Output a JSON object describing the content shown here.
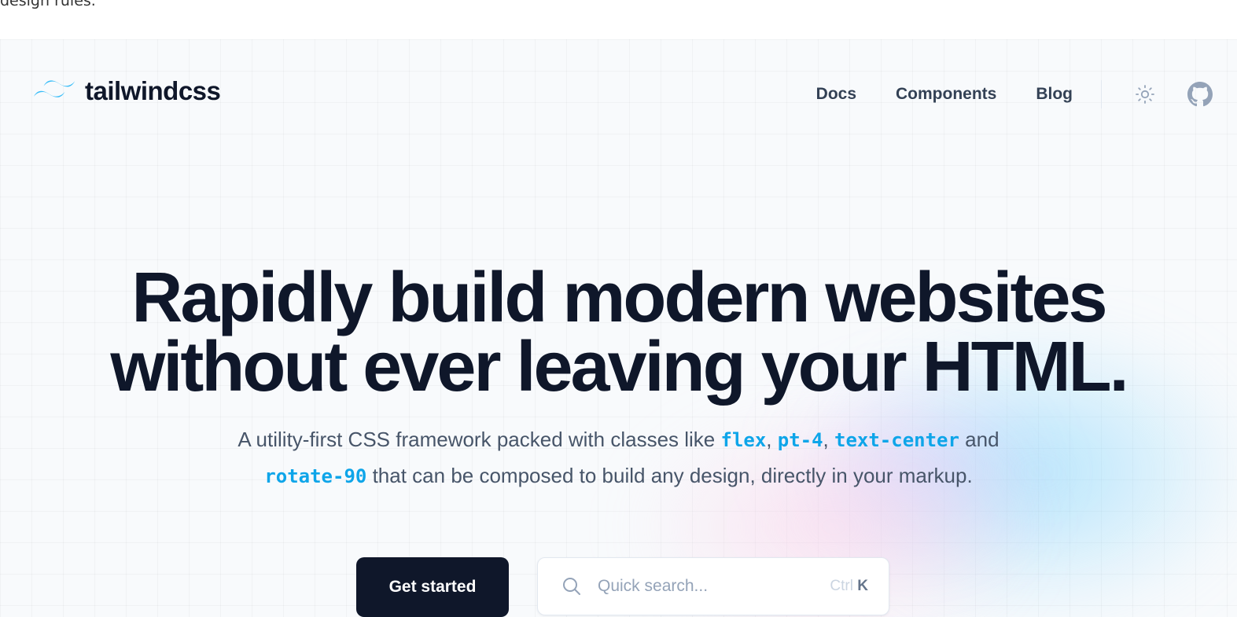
{
  "top_fragment": "design rules.",
  "navbar": {
    "logo_text": "tailwindcss",
    "links": [
      "Docs",
      "Components",
      "Blog"
    ],
    "theme_icon": "sun-icon",
    "github_icon": "github-icon"
  },
  "hero": {
    "headline_line1": "Rapidly build modern websites",
    "headline_line2": "without ever leaving your HTML.",
    "subtitle": {
      "part1": "A utility-first CSS framework packed with classes like ",
      "code1": "flex",
      "sep1": ", ",
      "code2": "pt-4",
      "sep2": ", ",
      "code3": "text-center",
      "part2": " and",
      "code4": "rotate-90",
      "part3": " that can be composed to build any design, directly in your markup."
    }
  },
  "cta": {
    "primary_label": "Get started",
    "search_placeholder": "Quick search...",
    "shortcut_modifier": "Ctrl",
    "shortcut_key": "K"
  },
  "colors": {
    "text_dark": "#0f172a",
    "accent": "#0ea5e9",
    "logo": "#38bdf8"
  }
}
